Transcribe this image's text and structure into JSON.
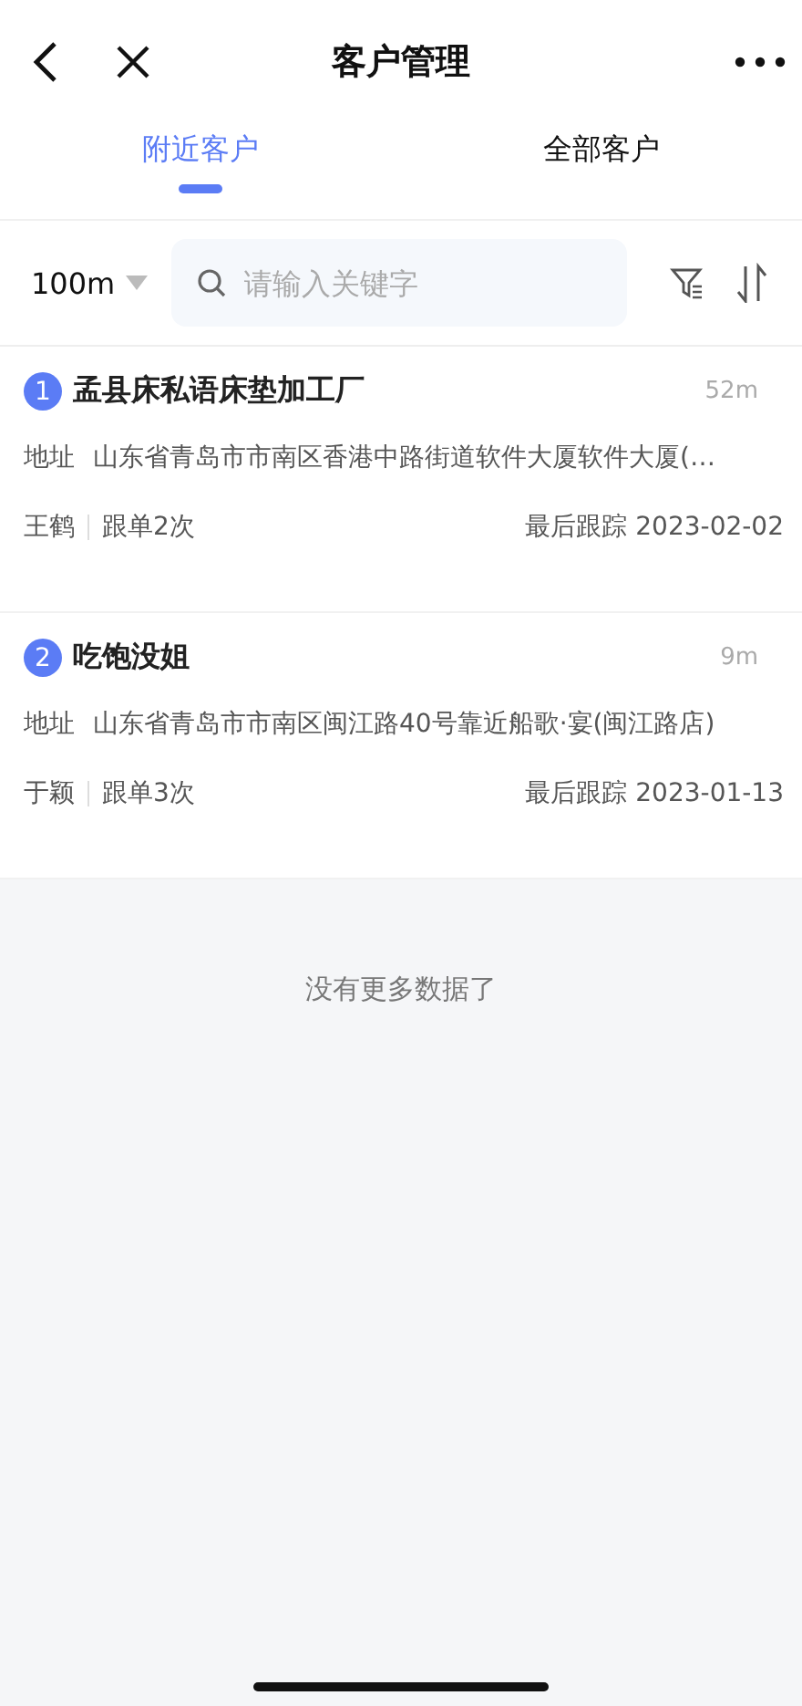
{
  "nav": {
    "title": "客户管理"
  },
  "tabs": [
    {
      "label": "附近客户",
      "selected": true
    },
    {
      "label": "全部客户",
      "selected": false
    }
  ],
  "filter": {
    "distance": "100m",
    "search": {
      "placeholder": "请输入关键字"
    }
  },
  "customers": [
    {
      "index": "1",
      "name": "孟县床私语床垫加工厂",
      "distance": "52m",
      "address_label": "地址",
      "address": "山东省青岛市市南区香港中路街道软件大厦软件大厦(…",
      "owner": "王鹤",
      "follow_count": "跟单2次",
      "last_follow": "最后跟踪 2023-02-02"
    },
    {
      "index": "2",
      "name": "吃饱没姐",
      "distance": "9m",
      "address_label": "地址",
      "address": "山东省青岛市市南区闽江路40号靠近船歌·宴(闽江路店)",
      "owner": "于颖",
      "follow_count": "跟单3次",
      "last_follow": "最后跟踪 2023-01-13"
    }
  ],
  "footer": "没有更多数据了"
}
